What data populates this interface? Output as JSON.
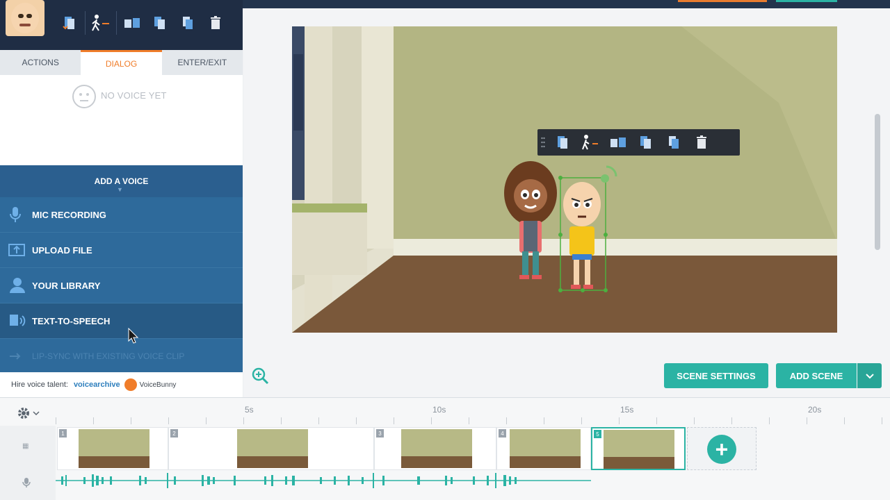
{
  "colors": {
    "accent_teal": "#2bb3a4",
    "accent_orange": "#f07d2a",
    "panel_blue": "#2e6a9b",
    "dark_navy": "#1f2d44"
  },
  "character_toolbar": {
    "icons": [
      "swap-character-icon",
      "walk-enter-icon",
      "flip-icon",
      "copy-icon",
      "paste-icon",
      "delete-icon"
    ]
  },
  "tabs": [
    {
      "label": "ACTIONS",
      "active": false
    },
    {
      "label": "DIALOG",
      "active": true
    },
    {
      "label": "ENTER/EXIT",
      "active": false
    }
  ],
  "dialog": {
    "no_voice_label": "NO VOICE YET"
  },
  "add_voice": {
    "title": "ADD A VOICE",
    "items": [
      {
        "label": "MIC RECORDING",
        "icon": "microphone-icon"
      },
      {
        "label": "UPLOAD FILE",
        "icon": "upload-icon"
      },
      {
        "label": "YOUR LIBRARY",
        "icon": "user-library-icon"
      },
      {
        "label": "TEXT-TO-SPEECH",
        "icon": "text-to-speech-icon"
      },
      {
        "label": "LIP-SYNC WITH EXISTING VOICE CLIP",
        "icon": "lipsync-icon",
        "disabled": true
      }
    ]
  },
  "hire": {
    "label": "Hire voice talent:",
    "brand1": "voicearchive",
    "brand2": "VoiceBunny"
  },
  "buttons": {
    "scene_settings": "SCENE SETTINGS",
    "add_scene": "ADD SCENE"
  },
  "timeline": {
    "ticks": [
      "5s",
      "10s",
      "15s",
      "20s"
    ],
    "scenes": [
      {
        "number": "1"
      },
      {
        "number": "2"
      },
      {
        "number": "3"
      },
      {
        "number": "4"
      },
      {
        "number": "5",
        "selected": true
      }
    ]
  }
}
